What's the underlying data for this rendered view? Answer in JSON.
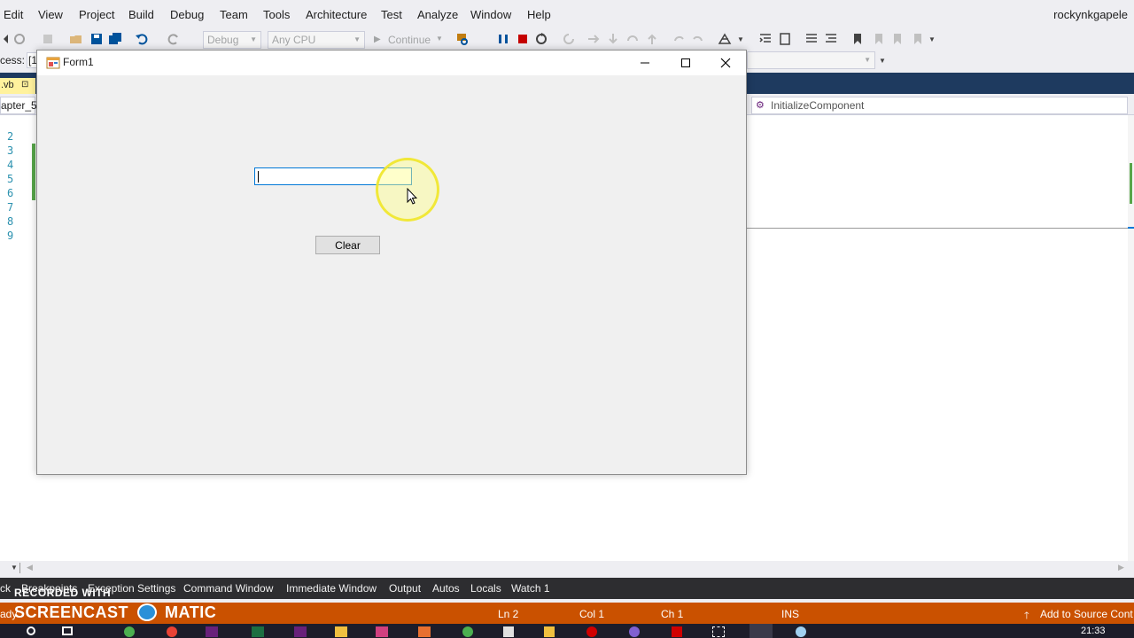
{
  "menubar": {
    "items": [
      "Edit",
      "View",
      "Project",
      "Build",
      "Debug",
      "Team",
      "Tools",
      "Architecture",
      "Test",
      "Analyze",
      "Window",
      "Help"
    ],
    "user": "rockynkgapele"
  },
  "toolbar": {
    "config": "Debug",
    "platform": "Any CPU",
    "continue_label": "Continue"
  },
  "process": {
    "label": "cess:",
    "value": "[1"
  },
  "editor": {
    "file_tab": ".vb",
    "project_dropdown": "apter_5",
    "member_dropdown": "InitializeComponent",
    "line_numbers": [
      "2",
      "3",
      "4",
      "5",
      "6",
      "7",
      "8",
      "9"
    ]
  },
  "form": {
    "title": "Form1",
    "textbox_value": "",
    "clear_button": "Clear"
  },
  "bottom_tabs": [
    "ck",
    "Breakpoints",
    "Exception Settings",
    "Command Window",
    "Immediate Window",
    "Output",
    "Autos",
    "Locals",
    "Watch 1"
  ],
  "status": {
    "ready": "ady",
    "ln": "Ln 2",
    "col": "Col 1",
    "ch": "Ch 1",
    "ins": "INS",
    "source_control": "Add to Source Cont"
  },
  "watermark": {
    "top": "RECORDED WITH",
    "left": "SCREENCAST",
    "right": "MATIC"
  },
  "taskbar": {
    "time": "21:33"
  },
  "colors": {
    "statusbar": "#ca5100",
    "accent": "#0078d7",
    "highlight": "#f0e628"
  }
}
